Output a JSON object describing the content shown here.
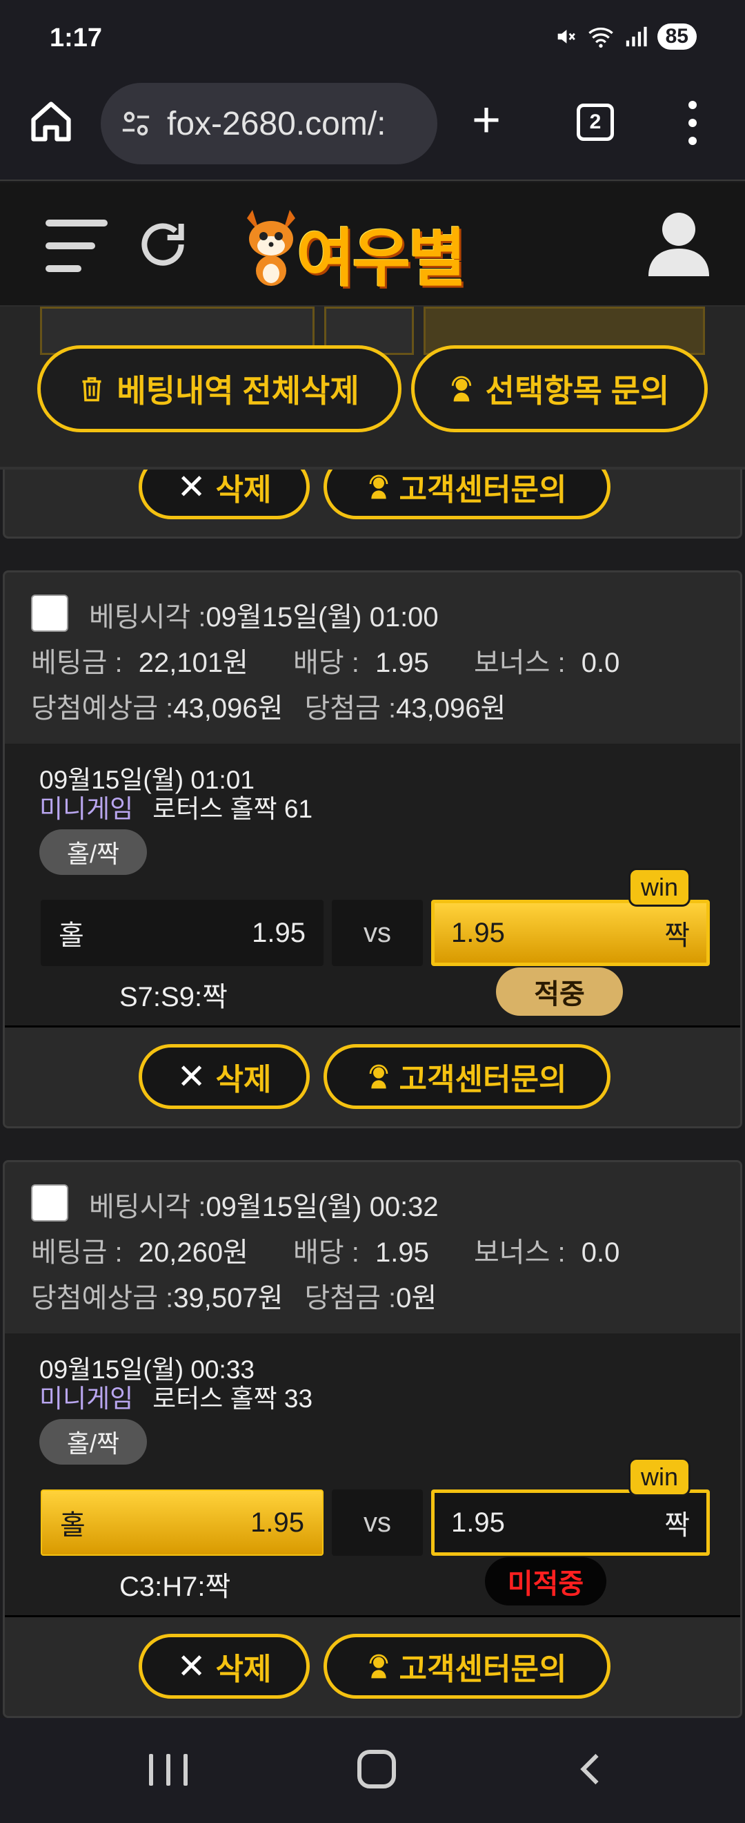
{
  "status_bar": {
    "time": "1:17",
    "battery": "85"
  },
  "browser": {
    "url": "fox-2680.com/:",
    "tab_count": "2"
  },
  "site": {
    "logo_text": "여우별"
  },
  "action_bar": {
    "delete_all_label": "베팅내역 전체삭제",
    "inquiry_selected_label": "선택항목 문의"
  },
  "top_card_buttons": {
    "delete_label": "삭제",
    "cs_label": "고객센터문의"
  },
  "cards": [
    {
      "bet_time_label": "베팅시각 :",
      "bet_time": "09월15일(월) 01:00",
      "amount_label": "베팅금 :",
      "amount": "22,101원",
      "odds_label": "배당 :",
      "odds": "1.95",
      "bonus_label": "보너스 :",
      "bonus": "0.0",
      "expected_label": "당첨예상금 :",
      "expected": "43,096원",
      "won_label": "당첨금 :",
      "won": "43,096원",
      "game_datetime": "09월15일(월) 01:01",
      "game_category": "미니게임",
      "game_name": "로터스 홀짝 61",
      "market": "홀/짝",
      "home_label": "홀",
      "home_odds": "1.95",
      "vs": "vs",
      "away_label": "짝",
      "away_odds": "1.95",
      "win_badge": "win",
      "result": "S7:S9:짝",
      "status": "적중",
      "delete_label": "삭제",
      "cs_label": "고객센터문의"
    },
    {
      "bet_time_label": "베팅시각 :",
      "bet_time": "09월15일(월) 00:32",
      "amount_label": "베팅금 :",
      "amount": "20,260원",
      "odds_label": "배당 :",
      "odds": "1.95",
      "bonus_label": "보너스 :",
      "bonus": "0.0",
      "expected_label": "당첨예상금 :",
      "expected": "39,507원",
      "won_label": "당첨금 :",
      "won": "0원",
      "game_datetime": "09월15일(월) 00:33",
      "game_category": "미니게임",
      "game_name": "로터스 홀짝 33",
      "market": "홀/짝",
      "home_label": "홀",
      "home_odds": "1.95",
      "vs": "vs",
      "away_label": "짝",
      "away_odds": "1.95",
      "win_badge": "win",
      "result": "C3:H7:짝",
      "status": "미적중",
      "delete_label": "삭제",
      "cs_label": "고객센터문의"
    }
  ],
  "colors": {
    "accent": "#f5c211",
    "miss": "#ff2020",
    "hit_badge": "#d9b266"
  }
}
